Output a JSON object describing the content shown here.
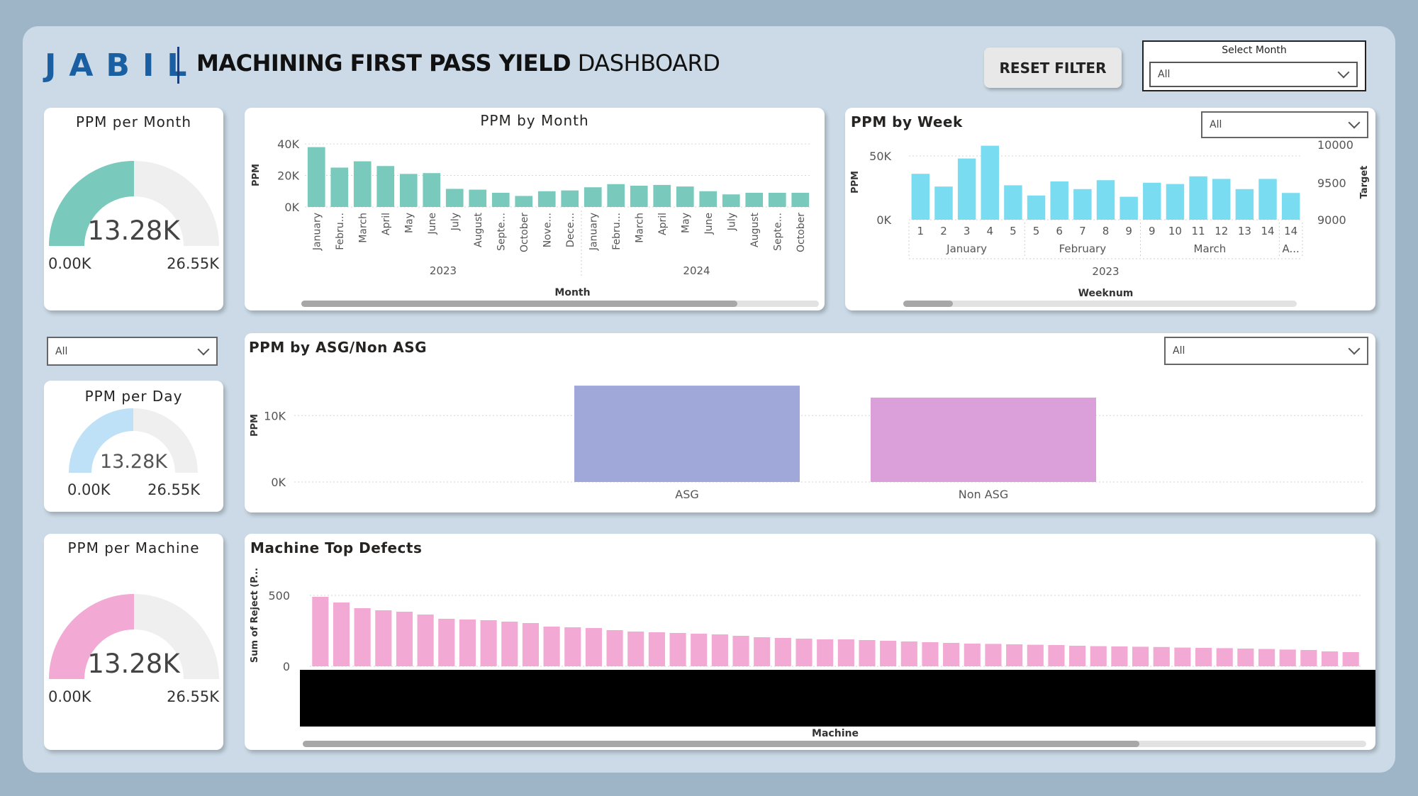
{
  "header": {
    "logo_text": "JABIL",
    "title_bold": "MACHINING FIRST PASS YIELD",
    "title_rest": " DASHBOARD",
    "reset_label": "RESET FILTER",
    "select_month_label": "Select Month",
    "select_month_value": "All"
  },
  "colors": {
    "brand": "#1b5fa3",
    "teal": "#79cabd",
    "light_blue": "#bfe1f7",
    "pink": "#f2aad4",
    "cyan": "#7adcf0",
    "asg": "#a0a8da",
    "non_asg": "#db9fd9"
  },
  "gauges": [
    {
      "title": "PPM per Month",
      "value": "13.28K",
      "min": "0.00K",
      "max": "26.55K",
      "fraction": 0.5,
      "color": "#79cabd"
    },
    {
      "title": "PPM per Day",
      "value": "13.28K",
      "min": "0.00K",
      "max": "26.55K",
      "fraction": 0.5,
      "color": "#bfe1f7"
    },
    {
      "title": "PPM per Machine",
      "value": "13.28K",
      "min": "0.00K",
      "max": "26.55K",
      "fraction": 0.5,
      "color": "#f2aad4"
    }
  ],
  "day_filter": {
    "value": "All"
  },
  "week_filter": {
    "value": "All"
  },
  "asg_filter": {
    "value": "All"
  },
  "chart_data": [
    {
      "id": "ppm-by-month",
      "type": "bar",
      "title": "PPM by Month",
      "xlabel": "Month",
      "ylabel": "PPM",
      "yticks": [
        "40K",
        "20K",
        "0K"
      ],
      "ylim": [
        0,
        45000
      ],
      "categories": [
        "January",
        "Febru...",
        "March",
        "April",
        "May",
        "June",
        "July",
        "August",
        "Septe...",
        "October",
        "Nove...",
        "Dece...",
        "January",
        "Febru...",
        "March",
        "April",
        "May",
        "June",
        "July",
        "August",
        "Septe...",
        "October"
      ],
      "groups": [
        {
          "label": "2023",
          "count": 12
        },
        {
          "label": "2024",
          "count": 10
        }
      ],
      "values": [
        38000,
        25000,
        29000,
        26000,
        21000,
        21500,
        11500,
        11000,
        9000,
        7000,
        10000,
        10500,
        12500,
        14500,
        13500,
        14000,
        13000,
        10000,
        8000,
        9000,
        9000,
        9000
      ],
      "color": "#79cabd",
      "grid": true
    },
    {
      "id": "ppm-by-week",
      "type": "bar",
      "title": "PPM by Week",
      "xlabel": "Weeknum",
      "ylabel": "PPM",
      "y2label": "Target",
      "yticks": [
        "50K",
        "0K"
      ],
      "y2ticks": [
        "10000",
        "9500",
        "9000"
      ],
      "ylim": [
        0,
        60000
      ],
      "categories": [
        "1",
        "2",
        "3",
        "4",
        "5",
        "5",
        "6",
        "7",
        "8",
        "9",
        "9",
        "10",
        "11",
        "12",
        "13",
        "14",
        "14"
      ],
      "groups": [
        {
          "label": "January",
          "count": 5
        },
        {
          "label": "February",
          "count": 5
        },
        {
          "label": "March",
          "count": 6
        },
        {
          "label": "A...",
          "count": 1
        }
      ],
      "year": "2023",
      "values": [
        36000,
        26000,
        48000,
        58000,
        27000,
        19000,
        30000,
        24000,
        31000,
        18000,
        29000,
        28000,
        34000,
        32000,
        24000,
        32000,
        21000
      ],
      "color": "#7adcf0",
      "grid": true
    },
    {
      "id": "ppm-by-asg",
      "type": "bar",
      "title": "PPM by ASG/Non ASG",
      "ylabel": "PPM",
      "yticks": [
        "10K",
        "0K"
      ],
      "ylim": [
        0,
        16000
      ],
      "categories": [
        "ASG",
        "Non ASG"
      ],
      "values": [
        14500,
        12700
      ],
      "colors": [
        "#a0a8da",
        "#db9fd9"
      ],
      "grid": true
    },
    {
      "id": "machine-top-defects",
      "type": "bar",
      "title": "Machine Top Defects",
      "xlabel": "Machine",
      "ylabel": "Sum of Reject (P...",
      "yticks": [
        "500",
        "0"
      ],
      "ylim": [
        0,
        560
      ],
      "values": [
        490,
        450,
        410,
        395,
        385,
        365,
        335,
        330,
        325,
        315,
        305,
        280,
        275,
        270,
        255,
        245,
        240,
        235,
        230,
        225,
        215,
        205,
        200,
        195,
        190,
        190,
        185,
        180,
        175,
        170,
        165,
        160,
        158,
        155,
        152,
        150,
        145,
        142,
        140,
        138,
        136,
        132,
        130,
        128,
        125,
        122,
        118,
        115,
        105,
        100
      ],
      "color": "#f2aad4",
      "grid": true
    }
  ]
}
